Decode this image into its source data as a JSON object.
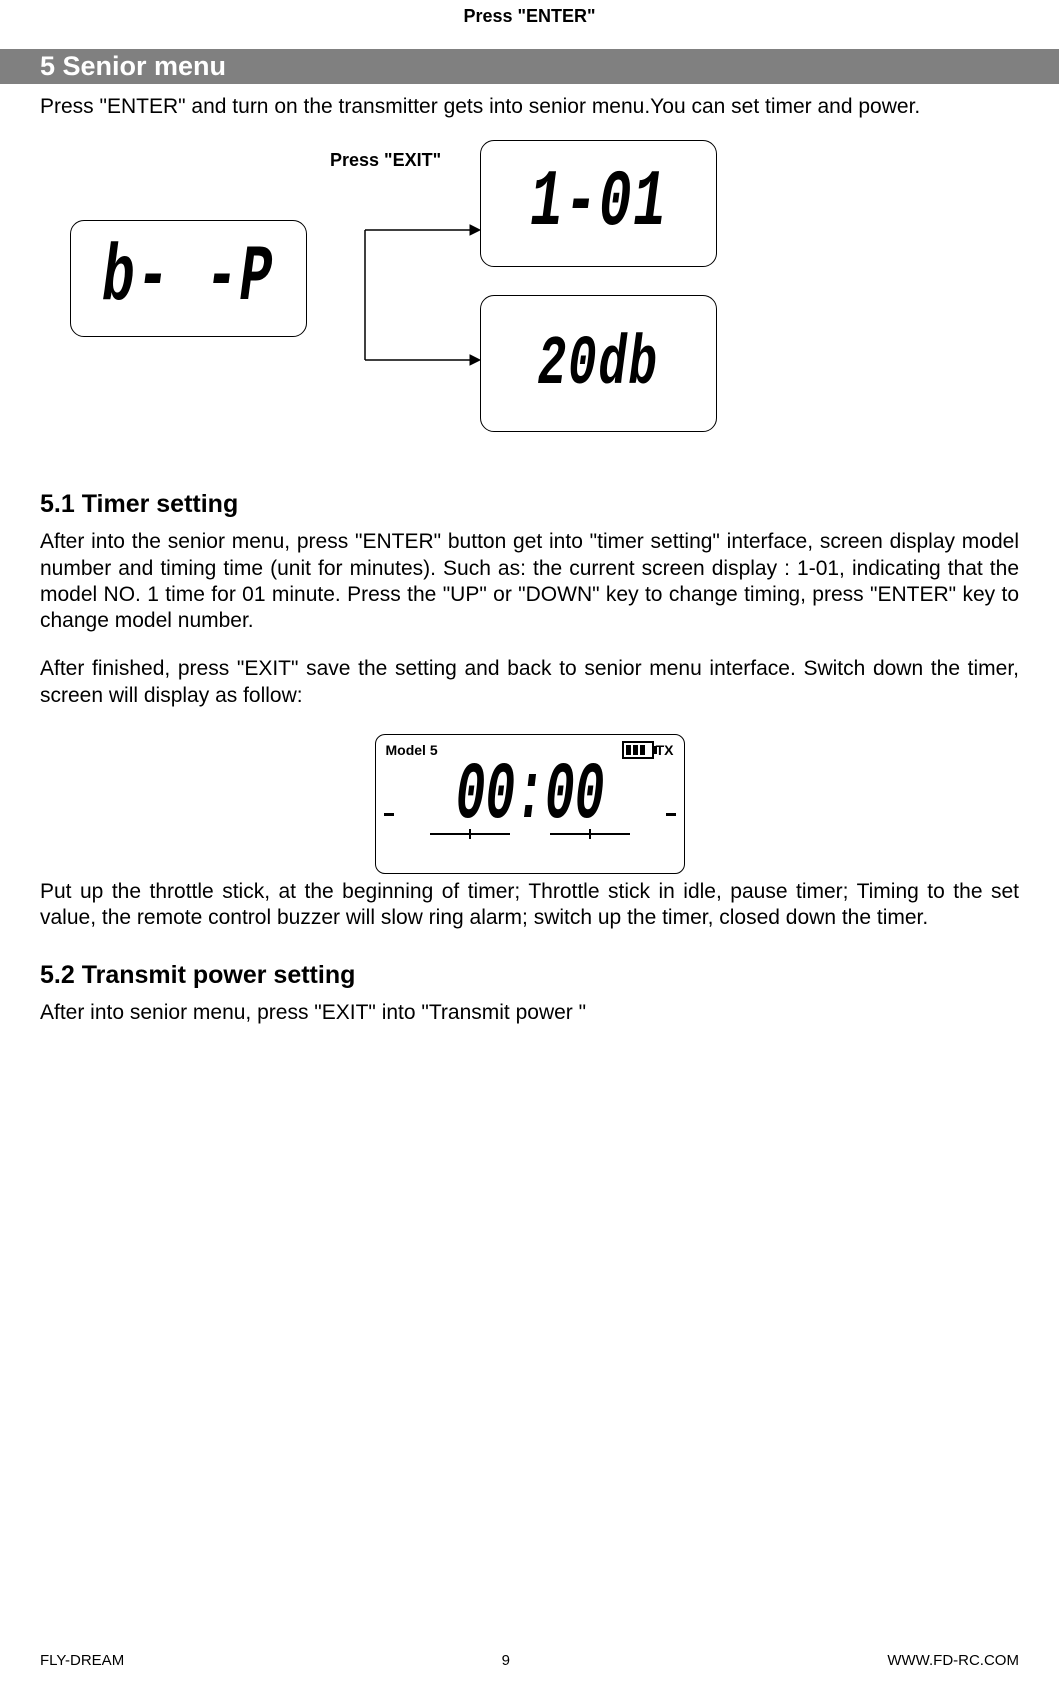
{
  "top_caption": "Press \"ENTER\"",
  "section5": {
    "title": "5 Senior menu",
    "intro": "Press \"ENTER\" and turn on the transmitter gets into senior menu.You can set timer and power."
  },
  "diagram": {
    "exit_label": "Press \"EXIT\"",
    "lcd_left": "b- -P",
    "lcd_top_right": "1-01",
    "lcd_bottom_right": "20db"
  },
  "section5_1": {
    "heading": "5.1 Timer setting",
    "p1": "After into the senior menu, press \"ENTER\" button get into \"timer setting\" interface, screen display model number and timing time (unit for minutes). Such as: the current screen display : 1-01, indicating that the model NO. 1 time for 01 minute. Press the \"UP\" or \"DOWN\" key to change timing, press \"ENTER\" key to change model number.",
    "p2": "After finished, press \"EXIT\" save the setting and back to senior menu interface. Switch down the timer, screen will display as follow:",
    "p3": "Put up the throttle stick, at the beginning of timer; Throttle stick in idle, pause timer; Timing to the set value, the remote control buzzer will slow ring alarm; switch up the timer, closed down the timer."
  },
  "timer_lcd": {
    "model_label": "Model 5",
    "tx_label": "TX",
    "digits": "00:00"
  },
  "section5_2": {
    "heading": "5.2 Transmit power setting",
    "p1": "After into senior menu, press \"EXIT\" into \"Transmit power \""
  },
  "footer": {
    "left": "FLY-DREAM",
    "center": "9",
    "right": "WWW.FD-RC.COM"
  }
}
